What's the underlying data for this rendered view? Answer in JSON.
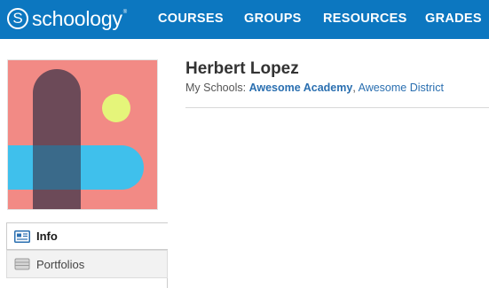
{
  "header": {
    "brand": "schoology",
    "brand_mark": "S",
    "brand_tm": "®",
    "nav": {
      "courses": "COURSES",
      "groups": "GROUPS",
      "resources": "RESOURCES",
      "grades": "GRADES"
    },
    "background_color": "#0c77c0"
  },
  "profile": {
    "name": "Herbert Lopez",
    "schools_label": "My Schools:",
    "school_primary": "Awesome Academy",
    "separator": ",",
    "school_district": "Awesome District",
    "avatar_colors": {
      "background": "#f28a85",
      "pill_vertical": "#6c4a58",
      "pill_horizontal": "#3fc0ec",
      "overlap": "#3a6a8a",
      "dot": "#e5f57a"
    }
  },
  "sidenav": {
    "items": [
      {
        "label": "Info",
        "icon": "info-card-icon",
        "active": true
      },
      {
        "label": "Portfolios",
        "icon": "portfolio-icon",
        "active": false
      }
    ]
  }
}
